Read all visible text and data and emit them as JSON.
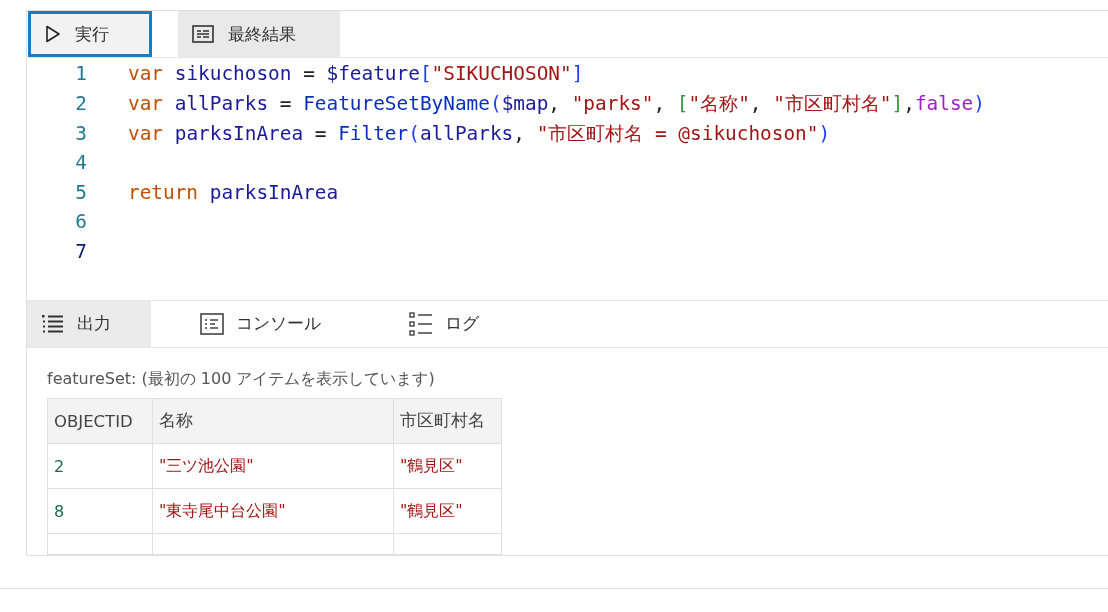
{
  "toolbar": {
    "run_button": {
      "label": "実行",
      "focused": true
    },
    "result_button": {
      "label": "最終結果",
      "selected": true
    }
  },
  "editor": {
    "lines": [
      {
        "number": "1",
        "current": false,
        "tokens": [
          {
            "kind": "keyword",
            "text": "var"
          },
          {
            "kind": "variable",
            "text": "sikuchoson"
          },
          {
            "kind": "operator",
            "text": " = "
          },
          {
            "kind": "variable",
            "text": "$feature"
          },
          {
            "kind": "bracket1",
            "text": "["
          },
          {
            "kind": "string",
            "text": "\"SIKUCHOSON\""
          },
          {
            "kind": "bracket1",
            "text": "]"
          }
        ]
      },
      {
        "number": "2",
        "current": false,
        "tokens": [
          {
            "kind": "keyword",
            "text": "var"
          },
          {
            "kind": "variable",
            "text": "allParks"
          },
          {
            "kind": "operator",
            "text": " = "
          },
          {
            "kind": "function",
            "text": "FeatureSetByName"
          },
          {
            "kind": "bracket1",
            "text": "("
          },
          {
            "kind": "variable",
            "text": "$map"
          },
          {
            "kind": "operator",
            "text": ", "
          },
          {
            "kind": "string",
            "text": "\"parks\""
          },
          {
            "kind": "operator",
            "text": ", "
          },
          {
            "kind": "bracket2",
            "text": "["
          },
          {
            "kind": "string",
            "text": "\"名称\""
          },
          {
            "kind": "operator",
            "text": ", "
          },
          {
            "kind": "string",
            "text": "\"市区町村名\""
          },
          {
            "kind": "bracket2",
            "text": "]"
          },
          {
            "kind": "operator",
            "text": ","
          },
          {
            "kind": "bool",
            "text": "false"
          },
          {
            "kind": "bracket1",
            "text": ")"
          }
        ]
      },
      {
        "number": "3",
        "current": false,
        "tokens": [
          {
            "kind": "keyword",
            "text": "var"
          },
          {
            "kind": "variable",
            "text": "parksInArea"
          },
          {
            "kind": "operator",
            "text": " = "
          },
          {
            "kind": "function",
            "text": "Filter"
          },
          {
            "kind": "bracket1",
            "text": "("
          },
          {
            "kind": "variable",
            "text": "allParks"
          },
          {
            "kind": "operator",
            "text": ", "
          },
          {
            "kind": "string",
            "text": "\"市区町村名 = @sikuchoson\""
          },
          {
            "kind": "bracket1",
            "text": ")"
          }
        ]
      },
      {
        "number": "4",
        "current": false
      },
      {
        "number": "5",
        "current": false,
        "tokens": [
          {
            "kind": "keyword",
            "text": "return"
          },
          {
            "kind": "variable",
            "text": "parksInArea"
          }
        ]
      },
      {
        "number": "6",
        "current": false
      },
      {
        "number": "7",
        "current": true
      }
    ]
  },
  "output_tabs": [
    {
      "label": "出力",
      "kind": "output",
      "selected": true
    },
    {
      "label": "コンソール",
      "kind": "console",
      "selected": false
    },
    {
      "label": "ログ",
      "kind": "log",
      "selected": false
    }
  ],
  "output": {
    "caption": "featureSet: (最初の 100 アイテムを表示しています)",
    "table": {
      "columns": [
        "OBJECTID",
        "名称",
        "市区町村名"
      ],
      "rows": [
        [
          "2",
          "\"三ツ池公園\"",
          "\"鶴見区\""
        ],
        [
          "8",
          "\"東寺尾中台公園\"",
          "\"鶴見区\""
        ]
      ]
    }
  }
}
